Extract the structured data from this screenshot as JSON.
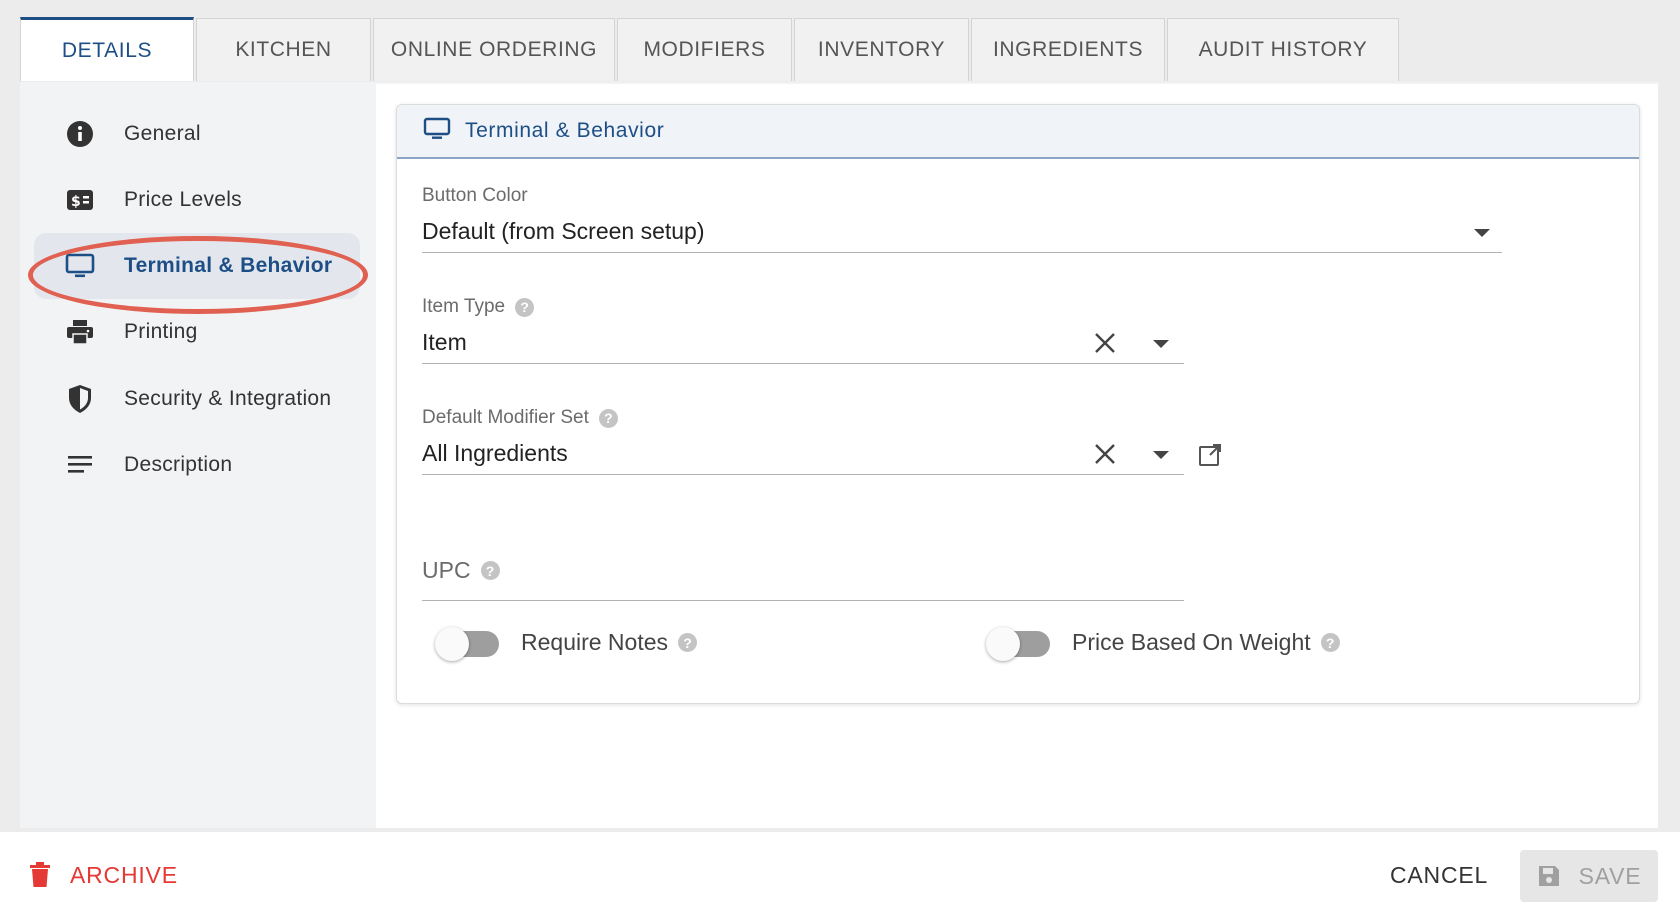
{
  "tabs": [
    {
      "label": "DETAILS",
      "active": true
    },
    {
      "label": "KITCHEN"
    },
    {
      "label": "ONLINE ORDERING"
    },
    {
      "label": "MODIFIERS"
    },
    {
      "label": "INVENTORY"
    },
    {
      "label": "INGREDIENTS"
    },
    {
      "label": "AUDIT HISTORY"
    }
  ],
  "sidebar": {
    "items": [
      {
        "label": "General",
        "icon": "info-icon"
      },
      {
        "label": "Price Levels",
        "icon": "dollar-icon"
      },
      {
        "label": "Terminal & Behavior",
        "icon": "monitor-icon",
        "active": true
      },
      {
        "label": "Printing",
        "icon": "printer-icon"
      },
      {
        "label": "Security & Integration",
        "icon": "shield-icon"
      },
      {
        "label": "Description",
        "icon": "notes-icon"
      }
    ]
  },
  "section": {
    "title": "Terminal & Behavior",
    "icon": "monitor-icon"
  },
  "fields": {
    "button_color": {
      "label": "Button Color",
      "value": "Default (from Screen setup)"
    },
    "item_type": {
      "label": "Item Type",
      "value": "Item"
    },
    "default_modifier_set": {
      "label": "Default Modifier Set",
      "value": "All Ingredients"
    },
    "upc": {
      "label": "UPC",
      "value": ""
    }
  },
  "toggles": {
    "require_notes": {
      "label": "Require Notes",
      "on": false
    },
    "price_based_on_weight": {
      "label": "Price Based On Weight",
      "on": false
    }
  },
  "footer": {
    "archive_label": "ARCHIVE",
    "cancel_label": "CANCEL",
    "save_label": "SAVE"
  },
  "colors": {
    "accent": "#1d4f86",
    "danger": "#e53935",
    "highlight_ring": "#e06151"
  }
}
